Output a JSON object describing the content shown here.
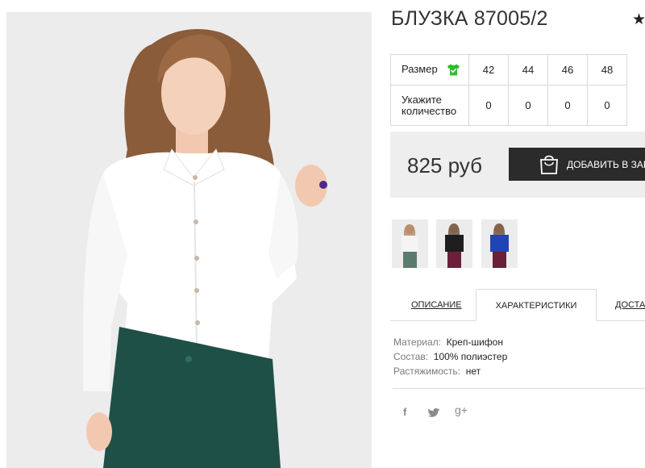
{
  "product": {
    "title": "БЛУЗКА 87005/2",
    "price": "825 руб",
    "add_button_label": "ДОБАВИТЬ В ЗАКАЗ"
  },
  "sizes": {
    "size_label": "Размер",
    "qty_label_line1": "Укажите",
    "qty_label_line2": "количество",
    "values": [
      "42",
      "44",
      "46",
      "48"
    ],
    "quantities": [
      "0",
      "0",
      "0",
      "0"
    ]
  },
  "tabs": [
    "ОПИСАНИЕ",
    "ХАРАКТЕРИСТИКИ",
    "ДОСТАВКА"
  ],
  "active_tab": "ХАРАКТЕРИСТИКИ",
  "specs": [
    {
      "key": "Материал:",
      "value": "Креп-шифон"
    },
    {
      "key": "Состав:",
      "value": "100% полиэстер"
    },
    {
      "key": "Растяжимость:",
      "value": "нет"
    }
  ],
  "thumbnails": [
    {
      "name": "white-blouse-thumb",
      "top_color": "#f4f4f4",
      "bottom_color": "#5d7a6f"
    },
    {
      "name": "black-blouse-thumb",
      "top_color": "#1e1e1e",
      "bottom_color": "#6b1f3a"
    },
    {
      "name": "blue-blouse-thumb",
      "top_color": "#1e44b5",
      "bottom_color": "#6b1f3a"
    }
  ],
  "social": {
    "facebook": "f",
    "twitter": "t",
    "google_plus": "g+"
  },
  "colors": {
    "button_bg": "#2b2b2b",
    "shirt_icon": "#2bbf2b",
    "price_box_bg": "#eeeeee"
  }
}
